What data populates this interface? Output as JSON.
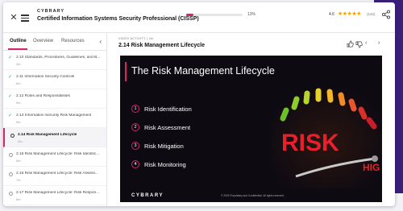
{
  "header": {
    "brand": "CYBRARY",
    "course_title": "Certified Information Systems Security Professional (CISSP)",
    "progress_pct_label": "13%",
    "progress_value": 0.13,
    "rating": "4.6",
    "stars": "★★★★★",
    "rating_count": "(142)"
  },
  "sidebar": {
    "tabs": [
      "Outline",
      "Overview",
      "Resources"
    ],
    "items": [
      {
        "label": "2.10 Standards, Procedures, Guidelines, and B...",
        "dur": "3m",
        "status": "done"
      },
      {
        "label": "2.11 Information Security Controls",
        "dur": "6m",
        "status": "done"
      },
      {
        "label": "2.12 Roles and Responsibilities",
        "dur": "9m",
        "status": "done"
      },
      {
        "label": "2.13 Information Security Risk Management",
        "dur": "9m",
        "status": "done"
      },
      {
        "label": "2.14 Risk Management Lifecycle",
        "dur": "2m",
        "status": "active"
      },
      {
        "label": "2.15 Risk Management Lifecycle: Risk Identific...",
        "dur": "5m",
        "status": "todo"
      },
      {
        "label": "2.16 Risk Management Lifecycle: Risk Assess...",
        "dur": "7m",
        "status": "todo"
      },
      {
        "label": "2.17 Risk Management Lifecycle: Risk Respon...",
        "dur": "8m",
        "status": "todo"
      }
    ]
  },
  "content": {
    "activity_type": "VIDEO ACTIVITY | 2m",
    "title": "2.14 Risk Management Lifecycle"
  },
  "slide": {
    "title": "The Risk Management Lifecycle",
    "steps": [
      {
        "num": "1",
        "text": "Risk Identification"
      },
      {
        "num": "2",
        "text": "Risk Assessment"
      },
      {
        "num": "3",
        "text": "Risk Mitigation"
      },
      {
        "num": "4",
        "text": "Risk Monitoring"
      }
    ],
    "gauge_word": "RISK",
    "gauge_hi": "HIG",
    "brand": "CYBRARY",
    "copyright": "© 2023 Proprietary and Confidential. All rights reserved."
  },
  "colors": {
    "accent": "#d6246e",
    "star": "#f2a100",
    "done": "#2fa86a"
  }
}
